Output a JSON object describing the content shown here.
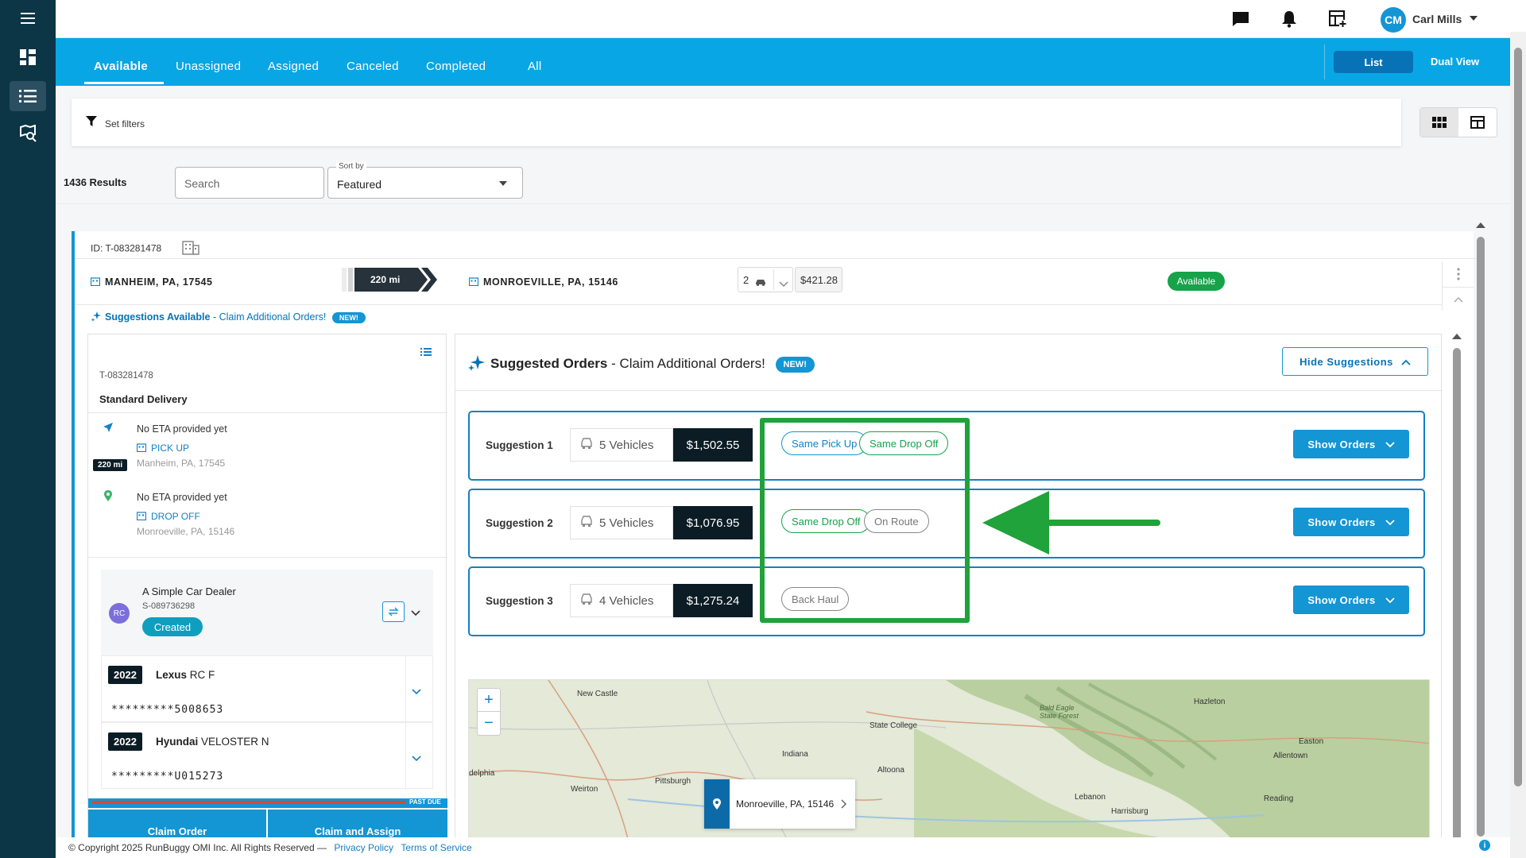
{
  "topbar": {
    "user_initials": "CM",
    "user_name": "Carl Mills",
    "icons": [
      "chat-icon",
      "bell-icon",
      "dashboard-add-icon"
    ]
  },
  "rail": {
    "icons": [
      "menu-icon",
      "dashboard-icon",
      "list-icon",
      "map-search-icon"
    ]
  },
  "tabs": [
    {
      "label": "Available",
      "active": true
    },
    {
      "label": "Unassigned"
    },
    {
      "label": "Assigned"
    },
    {
      "label": "Canceled"
    },
    {
      "label": "Completed"
    },
    {
      "label": "All"
    }
  ],
  "view_toggle": {
    "list": "List",
    "dual": "Dual View"
  },
  "filters": {
    "label": "Set filters"
  },
  "results": {
    "count": "1436 Results"
  },
  "search": {
    "placeholder": "Search"
  },
  "sort": {
    "label": "Sort by",
    "value": "Featured"
  },
  "order": {
    "id": "ID: T-083281478",
    "origin": "MANHEIM, PA, 17545",
    "destination": "MONROEVILLE, PA, 15146",
    "distance": "220 mi",
    "qty": "2",
    "price": "$421.28",
    "status": "Available",
    "suggestions_label": "Suggestions Available",
    "suggestions_link": "- Claim Additional Orders!",
    "new_badge": "NEW!"
  },
  "detail": {
    "tid": "T-083281478",
    "service": "Standard Delivery",
    "pickup": {
      "eta": "No ETA provided yet",
      "label": "PICK UP",
      "address": "Manheim, PA, 17545"
    },
    "dropoff": {
      "eta": "No ETA provided yet",
      "label": "DROP OFF",
      "address": "Monroeville, PA, 15146"
    },
    "distance": "220 mi",
    "dealer": {
      "initials": "RC",
      "name": "A Simple Car Dealer",
      "id": "S-089736298",
      "status": "Created"
    },
    "vehicles": [
      {
        "year": "2022",
        "make": "Lexus",
        "model": "RC F",
        "vin": "*********5008653"
      },
      {
        "year": "2022",
        "make": "Hyundai",
        "model": "VELOSTER N",
        "vin": "*********U015273"
      }
    ],
    "past_due": "PAST DUE",
    "claim_order": "Claim Order",
    "claim_assign": "Claim and Assign"
  },
  "suggested": {
    "title": "Suggested Orders",
    "subtitle": "- Claim Additional Orders!",
    "new_badge": "NEW!",
    "hide_button": "Hide Suggestions",
    "rows": [
      {
        "label": "Suggestion 1",
        "vehicles": "5 Vehicles",
        "amount": "$1,502.55",
        "tags": [
          "Same Pick Up",
          "Same Drop Off"
        ],
        "button": "Show Orders"
      },
      {
        "label": "Suggestion 2",
        "vehicles": "5 Vehicles",
        "amount": "$1,076.95",
        "tags": [
          "Same Drop Off",
          "On Route"
        ],
        "button": "Show Orders"
      },
      {
        "label": "Suggestion 3",
        "vehicles": "4 Vehicles",
        "amount": "$1,275.24",
        "tags": [
          "Back Haul"
        ],
        "button": "Show Orders"
      }
    ]
  },
  "map": {
    "tooltip": "Monroeville, PA, 15146",
    "labels": [
      "New Castle",
      "State College",
      "Hazleton",
      "Bald Eagle State Forest",
      "Indiana",
      "Altoona",
      "Easton",
      "Allentown",
      "Pittsburgh",
      "Weirton",
      "Lebanon",
      "Reading",
      "Harrisburg",
      "delphia"
    ]
  },
  "footer": {
    "copyright": "© Copyright 2025 RunBuggy OMI Inc. All Rights Reserved —",
    "privacy": "Privacy Policy",
    "terms": "Terms of Service"
  },
  "colors": {
    "accent": "#09a6e6",
    "rail": "#0c3546",
    "green_annotation": "#1fa33a",
    "status_green": "#16a34a"
  }
}
